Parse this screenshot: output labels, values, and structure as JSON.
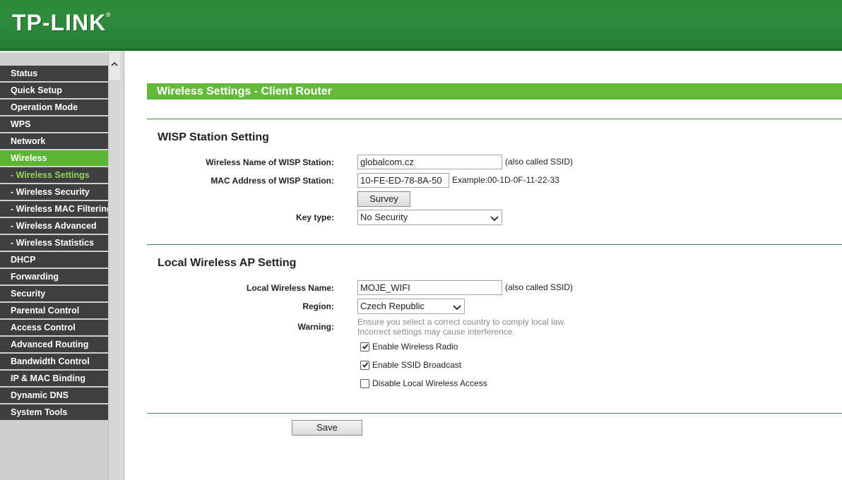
{
  "brand": {
    "logo_text": "TP-LINK",
    "logo_mark": "®",
    "header_color": "#2e8b3c",
    "accent": "#65b93a"
  },
  "sidebar": {
    "items": [
      {
        "label": "Status",
        "state": "normal"
      },
      {
        "label": "Quick Setup",
        "state": "normal"
      },
      {
        "label": "Operation Mode",
        "state": "normal"
      },
      {
        "label": "WPS",
        "state": "normal"
      },
      {
        "label": "Network",
        "state": "normal"
      },
      {
        "label": "Wireless",
        "state": "active"
      },
      {
        "label": "- Wireless Settings",
        "state": "sub-active"
      },
      {
        "label": "- Wireless Security",
        "state": "sub"
      },
      {
        "label": "- Wireless MAC Filtering",
        "state": "sub"
      },
      {
        "label": "- Wireless Advanced",
        "state": "sub"
      },
      {
        "label": "- Wireless Statistics",
        "state": "sub"
      },
      {
        "label": "DHCP",
        "state": "normal"
      },
      {
        "label": "Forwarding",
        "state": "normal"
      },
      {
        "label": "Security",
        "state": "normal"
      },
      {
        "label": "Parental Control",
        "state": "normal"
      },
      {
        "label": "Access Control",
        "state": "normal"
      },
      {
        "label": "Advanced Routing",
        "state": "normal"
      },
      {
        "label": "Bandwidth Control",
        "state": "normal"
      },
      {
        "label": "IP & MAC Binding",
        "state": "normal"
      },
      {
        "label": "Dynamic DNS",
        "state": "normal"
      },
      {
        "label": "System Tools",
        "state": "normal"
      }
    ]
  },
  "main": {
    "page_title": "Wireless Settings - Client Router",
    "wisp": {
      "section_title": "WISP Station Setting",
      "ssid_label": "Wireless Name of WISP Station:",
      "ssid_value": "globalcom.cz",
      "ssid_hint": "(also called SSID)",
      "mac_label": "MAC Address of WISP Station:",
      "mac_value": "10-FE-ED-78-8A-50",
      "mac_hint": "Example:00-1D-0F-11-22-33",
      "survey_label": "Survey",
      "keytype_label": "Key type:",
      "keytype_value": "No Security"
    },
    "local": {
      "section_title": "Local Wireless AP Setting",
      "name_label": "Local Wireless Name:",
      "name_value": "MOJE_WIFI",
      "name_hint": "(also called SSID)",
      "region_label": "Region:",
      "region_value": "Czech Republic",
      "warning_label": "Warning:",
      "warning_line1": "Ensure you select a correct country to comply local law.",
      "warning_line2": "Incorrect settings may cause interference.",
      "checkboxes": [
        {
          "label": "Enable Wireless Radio",
          "checked": true
        },
        {
          "label": "Enable SSID Broadcast",
          "checked": true
        },
        {
          "label": "Disable Local Wireless Access",
          "checked": false
        }
      ]
    },
    "save_label": "Save"
  }
}
